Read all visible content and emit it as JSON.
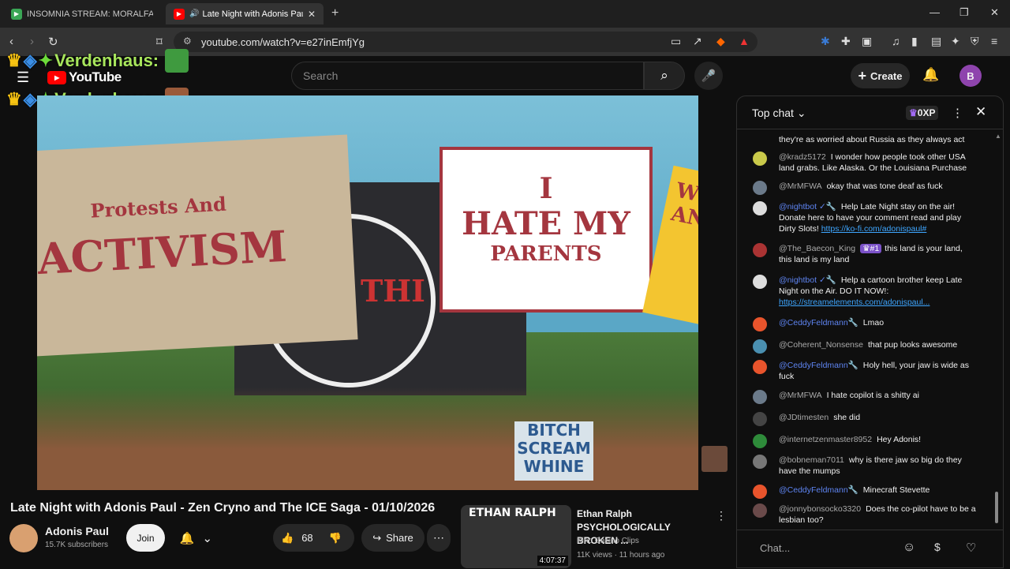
{
  "browser": {
    "tabs": [
      {
        "title": "INSOMNIA STREAM: MORALFAG ED",
        "favicon_color": "#3aa655"
      },
      {
        "title": "Late Night with Adonis Paul -",
        "favicon_color": "#ff0000"
      }
    ],
    "url": "youtube.com/watch?v=e27inEmfjYg"
  },
  "overlay": {
    "line1": "Verdenhaus:",
    "line2": "Verdenhaus:"
  },
  "youtube": {
    "logo": "YouTube",
    "search_placeholder": "Search",
    "create_label": "Create",
    "avatar_letter": "B"
  },
  "video": {
    "sign1_line1": "Protests And",
    "sign1_line2": "ACTIVISM",
    "board_text": "THI",
    "sign2_line1": "I",
    "sign2_line2": "HATE MY",
    "sign2_line3": "PARENTS",
    "sign3_text": "WE ANT",
    "sign4_line1": "BITCH",
    "sign4_line2": "SCREAM",
    "sign4_line3": "WHINE"
  },
  "info": {
    "title": "Late Night with Adonis Paul - Zen Cryno and The ICE Saga - 01/10/2026",
    "channel": "Adonis Paul",
    "subscribers": "15.7K subscribers",
    "join_label": "Join",
    "likes": "68",
    "share_label": "Share"
  },
  "recommended": {
    "thumb_text": "ETHAN RALPH",
    "duration": "4:07:37",
    "title": "Ethan Ralph PSYCHOLOGICALLY BROKEN ...",
    "channel": "Kino Casino Clips",
    "meta": "11K views · 11 hours ago"
  },
  "chat": {
    "header": "Top chat",
    "xp": "0XP",
    "input_placeholder": "Chat...",
    "messages": [
      {
        "author": "",
        "text": "they're as worried about Russia as they always act",
        "mod": false,
        "avatar": "#555"
      },
      {
        "author": "@kradz5172",
        "text": "I wonder how people took other USA land grabs. Like Alaska. Or the Louisiana Purchase",
        "mod": false,
        "avatar": "#c9c94a"
      },
      {
        "author": "@MrMFWA",
        "text": "okay that was tone deaf as fuck",
        "mod": false,
        "avatar": "#6b7a8a"
      },
      {
        "author": "@nightbot ✓🔧",
        "text": "Help Late Night stay on the air! Donate here to have your comment read and play Dirty Slots! ",
        "link": "https://ko-fi.com/adonispaul#",
        "mod": true,
        "avatar": "#ddd"
      },
      {
        "author": "@The_Baecon_King",
        "badge": "♛#1",
        "text": "this land is your land, this land is my land",
        "mod": false,
        "avatar": "#a33"
      },
      {
        "author": "@nightbot ✓🔧",
        "text": "Help a cartoon brother keep Late Night on the Air. DO IT NOW!: ",
        "link": "https://streamelements.com/adonispaul...",
        "mod": true,
        "avatar": "#ddd"
      },
      {
        "author": "@CeddyFeldmann🔧",
        "text": "Lmao",
        "mod": true,
        "avatar": "#e8542c"
      },
      {
        "author": "@Coherent_Nonsense",
        "text": "that pup looks awesome",
        "mod": false,
        "avatar": "#4a8fb0"
      },
      {
        "author": "@CeddyFeldmann🔧",
        "text": "Holy hell, your jaw is wide as fuck",
        "mod": true,
        "avatar": "#e8542c"
      },
      {
        "author": "@MrMFWA",
        "text": "I hate copilot is a shitty ai",
        "mod": false,
        "avatar": "#6b7a8a"
      },
      {
        "author": "@JDtimesten",
        "text": "she did",
        "mod": false,
        "avatar": "#444"
      },
      {
        "author": "@internetzenmaster8952",
        "text": "Hey Adonis!",
        "mod": false,
        "avatar": "#2e8b3a"
      },
      {
        "author": "@bobneman7011",
        "text": "why is there jaw so big do they have the mumps",
        "mod": false,
        "avatar": "#777"
      },
      {
        "author": "@CeddyFeldmann🔧",
        "text": "Minecraft Stevette",
        "mod": true,
        "avatar": "#e8542c"
      },
      {
        "author": "@jonnybonsocko3320",
        "text": "Does the co-pilot have to be a lesbian too?",
        "mod": false,
        "avatar": "#6a4a4a"
      }
    ]
  }
}
